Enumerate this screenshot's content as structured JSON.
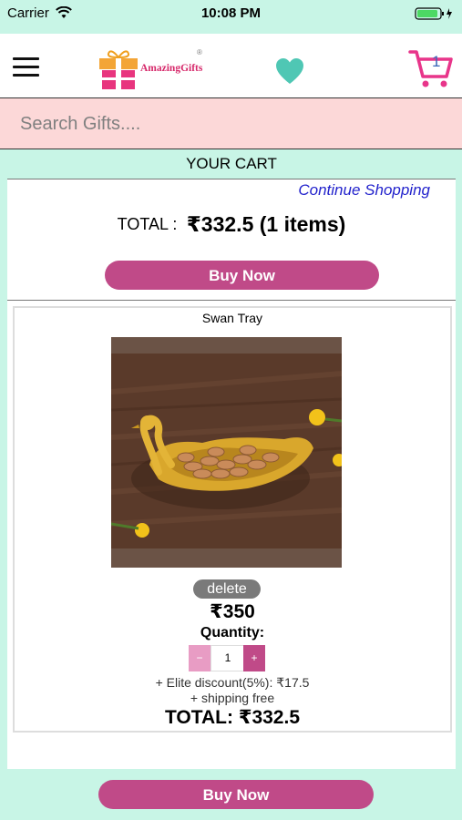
{
  "status_bar": {
    "carrier": "Carrier",
    "time": "10:08 PM"
  },
  "header": {
    "brand": "AmazingGifts",
    "cart_count": "1"
  },
  "search": {
    "placeholder": "Search Gifts...."
  },
  "cart": {
    "title": "YOUR CART",
    "continue_label": "Continue Shopping",
    "total_label": "TOTAL :",
    "total_value": "₹332.5 (1 items)",
    "buy_label": "Buy Now"
  },
  "item": {
    "name": "Swan Tray",
    "delete_label": "delete",
    "price": "₹350",
    "quantity_label": "Quantity:",
    "minus": "−",
    "quantity": "1",
    "plus": "+",
    "discount": "+ Elite discount(5%): ₹17.5",
    "shipping": "+ shipping free",
    "total": "TOTAL: ₹332.5"
  },
  "footer": {
    "buy_label": "Buy Now"
  },
  "colors": {
    "accent": "#c04a88",
    "background": "#c8f5e6",
    "search_bg": "#fcd8d8",
    "heart": "#4fc7b4",
    "cart_icon": "#e8358a"
  },
  "icons": [
    "wifi-icon",
    "battery-icon",
    "menu-icon",
    "gift-logo-icon",
    "heart-icon",
    "cart-icon"
  ]
}
